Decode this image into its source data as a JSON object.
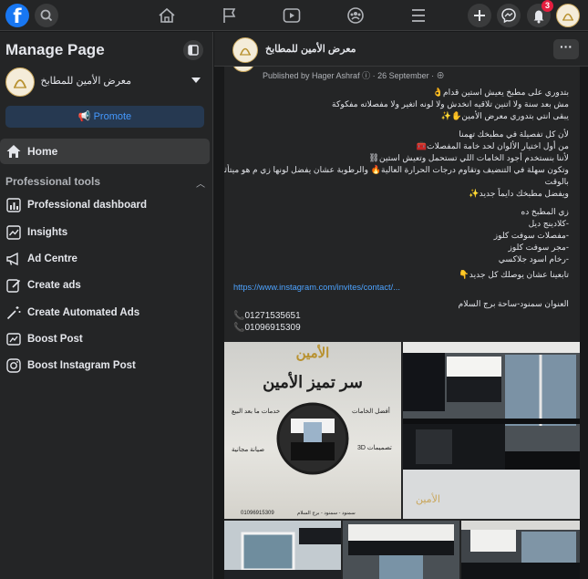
{
  "colors": {
    "accent": "#1877f2",
    "badge": "#e41e3f",
    "link": "#4da3ff",
    "bg": "#18191a",
    "surface": "#242526"
  },
  "topbar": {
    "logo_letter": "f",
    "notifications_count": "3"
  },
  "sidebar": {
    "title": "Manage Page",
    "page_name": "معرض الأمين للمطابخ",
    "promote_label": "Promote",
    "home_label": "Home",
    "section_title": "Professional tools",
    "tools": [
      {
        "label": "Professional dashboard",
        "icon": "dashboard-icon"
      },
      {
        "label": "Insights",
        "icon": "insights-icon"
      },
      {
        "label": "Ad Centre",
        "icon": "megaphone-icon"
      },
      {
        "label": "Create ads",
        "icon": "edit-icon"
      },
      {
        "label": "Create Automated Ads",
        "icon": "magic-wand-icon"
      },
      {
        "label": "Boost Post",
        "icon": "boost-icon"
      },
      {
        "label": "Boost Instagram Post",
        "icon": "instagram-icon"
      }
    ]
  },
  "header": {
    "page_name": "معرض الأمين للمطابخ",
    "more_label": "···"
  },
  "post": {
    "published_by": "Published by Hager Ashraf",
    "date": "26 September",
    "lines": [
      "بتدوري على مطبخ يعيش استين قدام👌",
      "مش بعد سنة ولا اتنين تلاقيه انخدش ولا لونه اتغير ولا مفصلاته مفكوكة",
      "يبقى انتي بتدوري معرض الأمين✋✨",
      "",
      "لأن كل تفصيلة في مطبخك تهمنا",
      "من أول اختيار الألوان لحد خامة المفصلات🧰",
      "لأننا بنستخدم أجود الخامات اللي تستحمل وتعيش استين⛓",
      "وتكون سهلة في التنضيف وتقاوم درجات الحرارة العالية🔥 والرطوبة عشان يفضل لونها زي م هو ميتأثرش",
      "بالوقت",
      "ويفضل مطبخك دايماً جديد✨",
      "",
      "زي المطبخ ده",
      "-كلادينج ديل",
      "-مفصلات سوفت كلوز",
      "-مجر سوفت كلوز",
      "-رخام اسود جلاكسي",
      "",
      "تابعينا عشان يوصلك كل جديد👇"
    ],
    "link": "https://www.instagram.com/invites/contact/...",
    "address": "العنوان سمنود-ساحة برج السلام",
    "phones": [
      "📞01271535651",
      "📞01096915309"
    ]
  },
  "ad_image": {
    "logo_text": "الأمين",
    "brand_latin": "ALAMEEN",
    "title": "سر تميز الأمين",
    "feature_1": "أفضل الخامات",
    "feature_2": "خدمات ما بعد البيع",
    "feature_3": "تصميمات 3D",
    "feature_4": "صيانة مجانية",
    "phone": "01096915309",
    "address": "سمنود - سمنود - برج السلام"
  }
}
